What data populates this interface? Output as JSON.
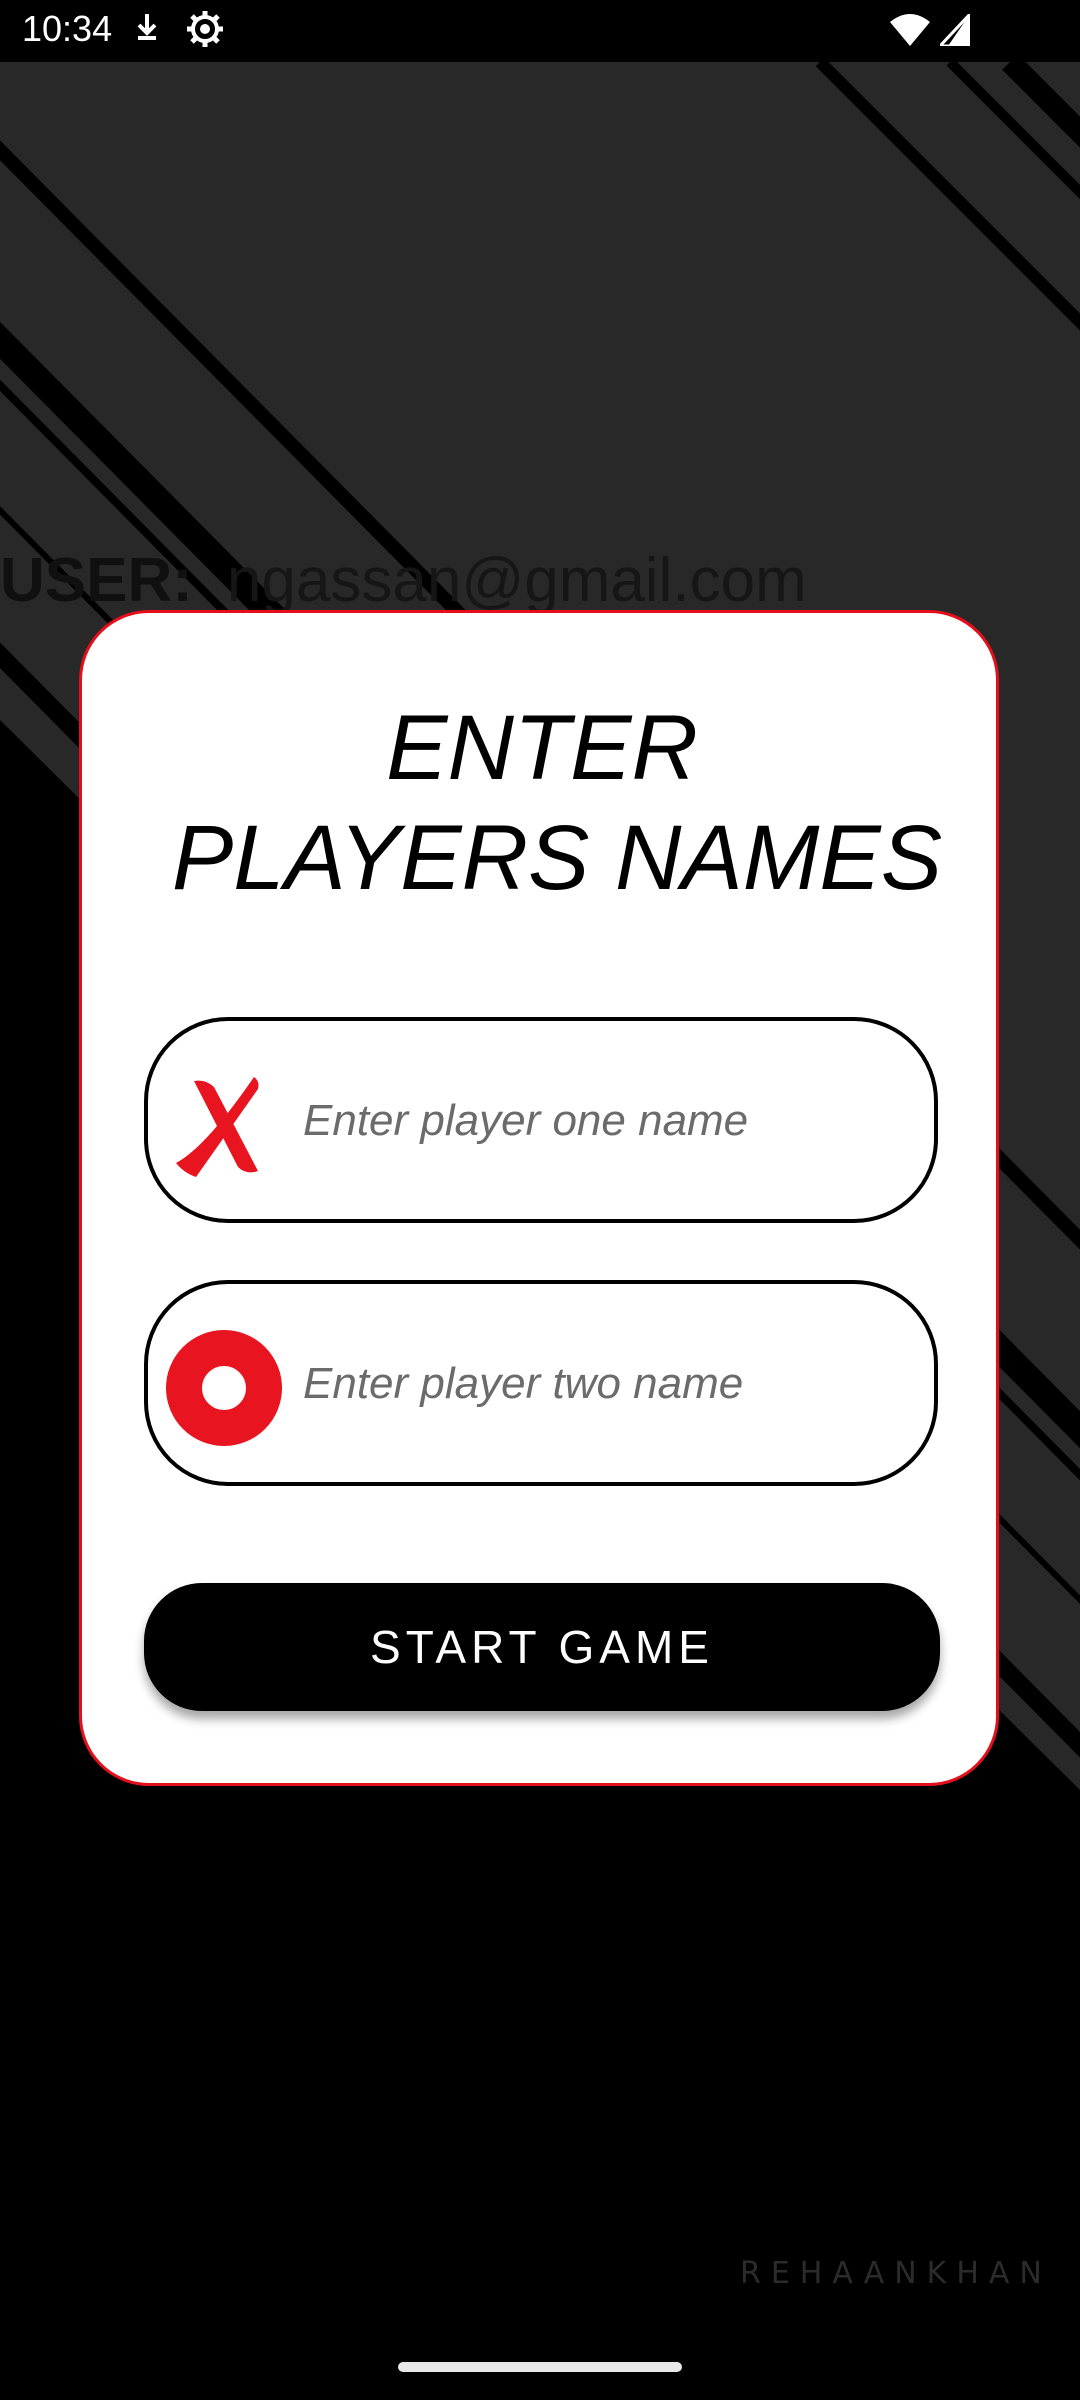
{
  "status_bar": {
    "time": "10:34",
    "icons": [
      "download-icon",
      "settings-icon",
      "wifi-icon",
      "signal-icon"
    ]
  },
  "background": {
    "user_label": "USER:",
    "user_email": "ngassan@gmail.com",
    "watermark": "REHAANKHAN"
  },
  "dialog": {
    "title_line1": "ENTER",
    "title_line2": "PLAYERS NAMES",
    "player_one": {
      "icon": "x-icon",
      "placeholder": "Enter player one name",
      "value": ""
    },
    "player_two": {
      "icon": "o-icon",
      "placeholder": "Enter player two name",
      "value": ""
    },
    "start_button_label": "START GAME"
  },
  "colors": {
    "accent_red": "#e3101c",
    "background": "#000000",
    "dialog_bg": "#ffffff"
  }
}
